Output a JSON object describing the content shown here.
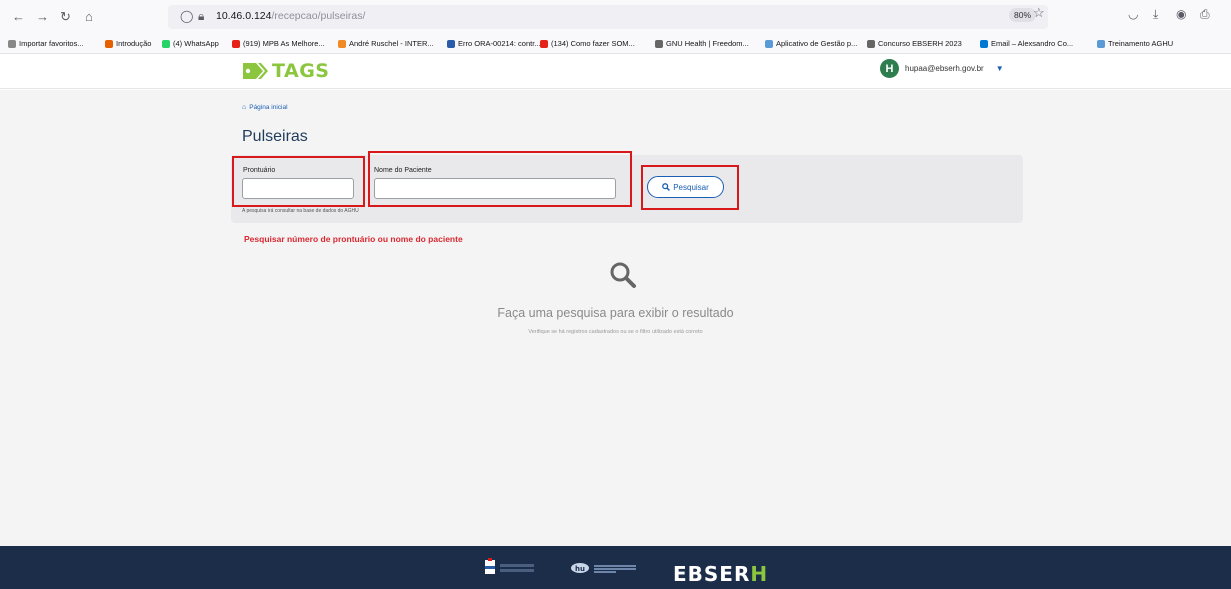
{
  "browser": {
    "url_host": "10.46.0.124",
    "url_path": "/recepcao/pulseiras/",
    "zoom": "80%",
    "bookmarks": [
      {
        "label": "Importar favoritos...",
        "color": "#888888"
      },
      {
        "label": "Introdução",
        "color": "#e66000"
      },
      {
        "label": "(4) WhatsApp",
        "color": "#25d366"
      },
      {
        "label": "(919) MPB As Melhore...",
        "color": "#e62117"
      },
      {
        "label": "André Ruschel - INTER...",
        "color": "#f08a24"
      },
      {
        "label": "Erro ORA-00214: contr...",
        "color": "#2a5caa"
      },
      {
        "label": "(134) Como fazer SOM...",
        "color": "#e62117"
      },
      {
        "label": "GNU Health | Freedom...",
        "color": "#666666"
      },
      {
        "label": "Aplicativo de Gestão p...",
        "color": "#5b9bd5"
      },
      {
        "label": "Concurso EBSERH 2023",
        "color": "#666666"
      },
      {
        "label": "Email – Alexsandro Co...",
        "color": "#0078d4"
      },
      {
        "label": "Treinamento AGHU",
        "color": "#5b9bd5"
      }
    ]
  },
  "header": {
    "logo_text": "TAGS",
    "avatar_letter": "H",
    "user_email": "hupaa@ebserh.gov.br"
  },
  "main": {
    "breadcrumb": "Página inicial",
    "title": "Pulseiras",
    "search": {
      "prontuario_label": "Prontuário",
      "nome_label": "Nome do Paciente",
      "button_label": "Pesquisar",
      "help_text": "A pesquisa irá consultar na base de dados do AGHU"
    },
    "warning": "Pesquisar número de prontuário ou nome do paciente",
    "empty_title": "Faça uma pesquisa para exibir o resultado",
    "empty_sub": "Verifique se há registros cadastrados ou se o filtro utilizado está correto"
  },
  "footer": {
    "brand": "EBSER",
    "brand_last": "H"
  },
  "colors": {
    "accent": "#1a5fb4",
    "brand_green": "#8cc63f",
    "highlight": "#d7191c",
    "footer_bg": "#1c2d4a"
  }
}
